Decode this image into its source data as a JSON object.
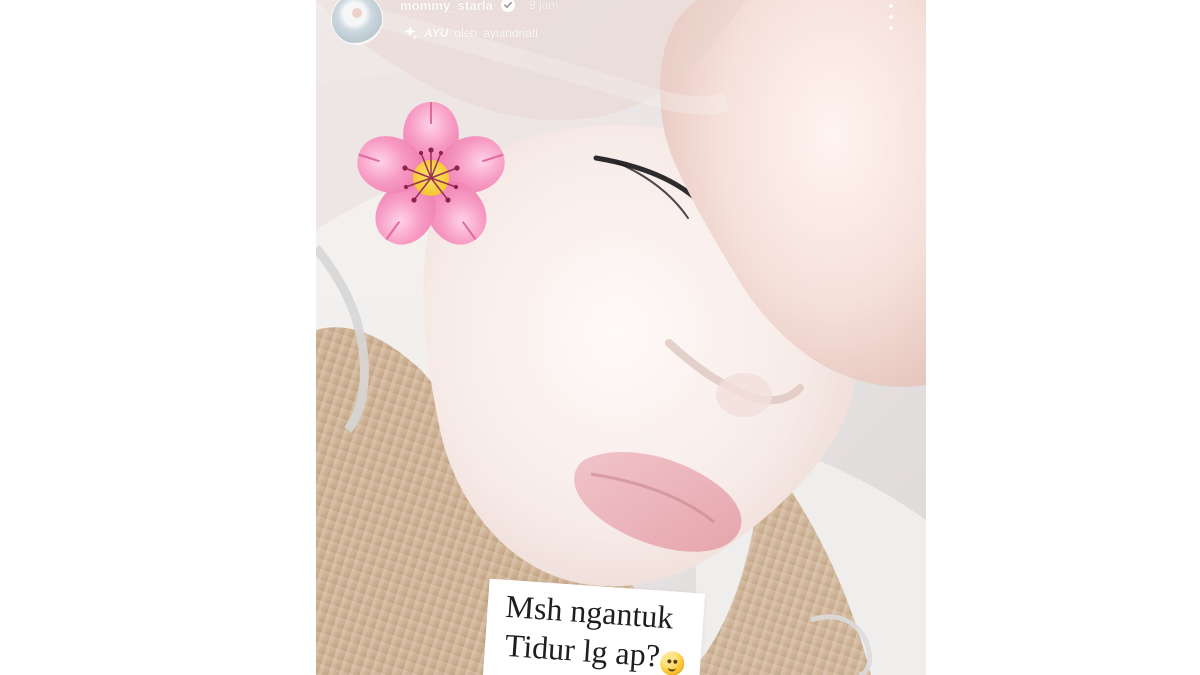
{
  "story": {
    "header": {
      "username": "mommy_starla",
      "time": "9 jam",
      "effect_name": "AYU",
      "effect_by": "oleh",
      "effect_author": "ayuindriati"
    },
    "sticker_text": {
      "line1": "Msh ngantuk",
      "line2": "Tidur lg ap?"
    }
  },
  "icons": {
    "verified": "check-badge",
    "effect": "sparkle",
    "more": "vertical-ellipsis",
    "flower": "cherry-blossom",
    "emoji": "smiling-face"
  },
  "colors": {
    "page_background": "#ffffff",
    "header_text": "#ffffff",
    "flower_petal": "#f48fb1",
    "flower_center": "#f4c542",
    "sticker_background": "#ffffff",
    "sticker_text": "#1e1e1e"
  }
}
